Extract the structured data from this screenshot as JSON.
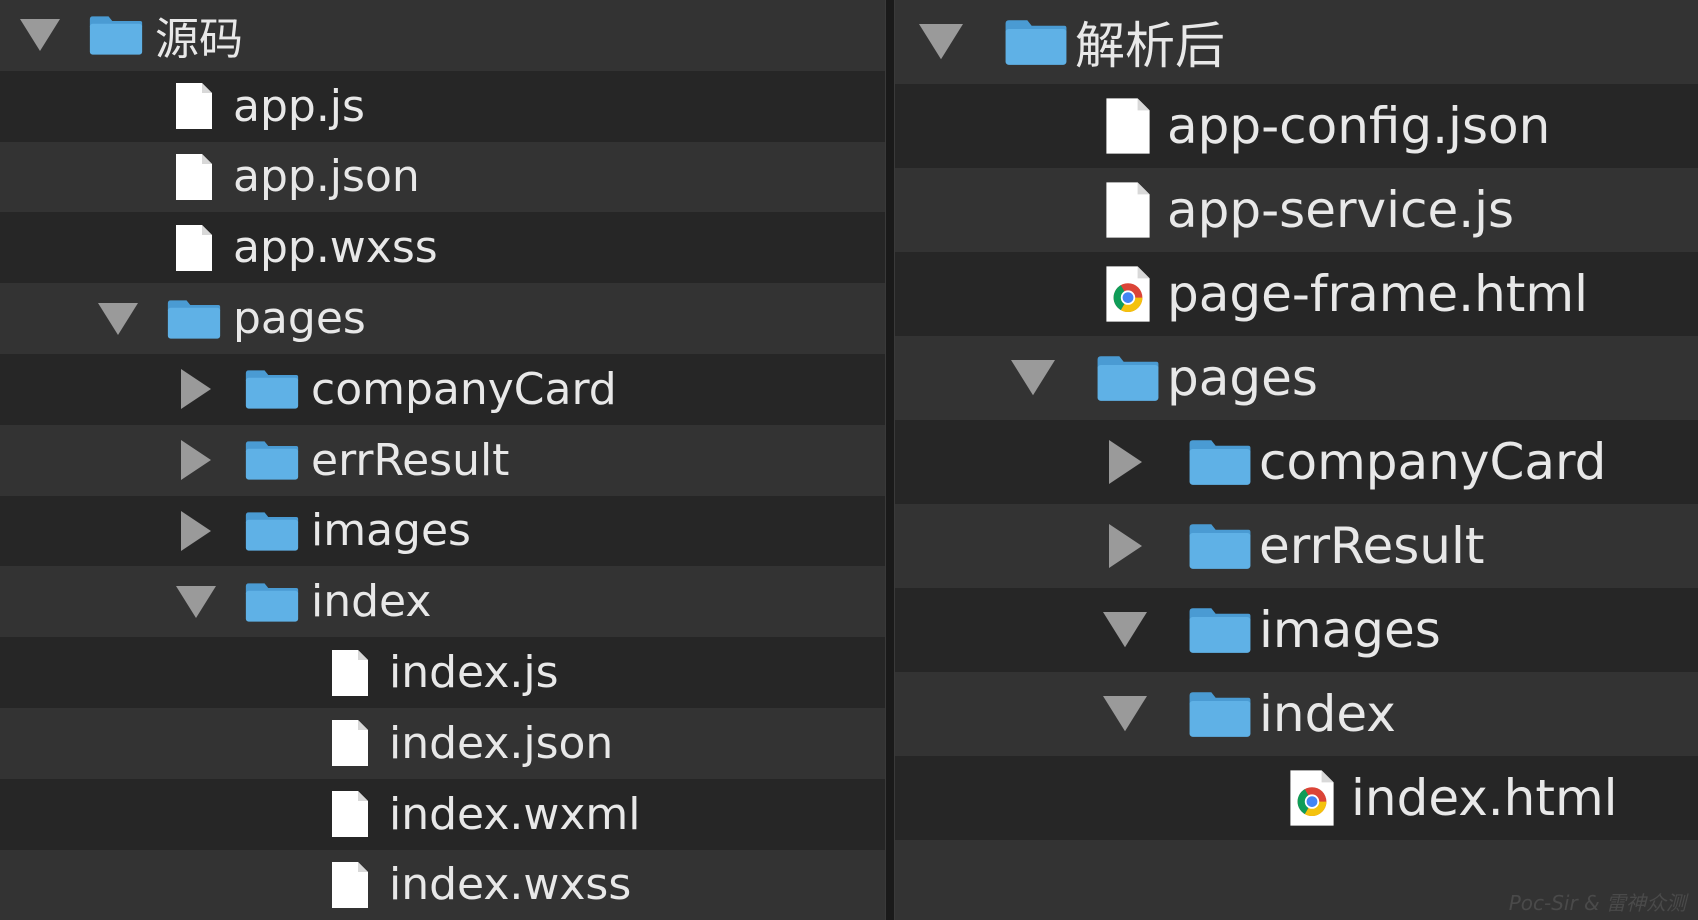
{
  "panes": [
    {
      "id": "left",
      "items": [
        {
          "label": "源码",
          "type": "folder",
          "expanded": true,
          "depth": 0
        },
        {
          "label": "app.js",
          "type": "file",
          "depth": 1
        },
        {
          "label": "app.json",
          "type": "file",
          "depth": 1
        },
        {
          "label": "app.wxss",
          "type": "file",
          "depth": 1
        },
        {
          "label": "pages",
          "type": "folder",
          "expanded": true,
          "depth": 1
        },
        {
          "label": "companyCard",
          "type": "folder",
          "expanded": false,
          "depth": 2
        },
        {
          "label": "errResult",
          "type": "folder",
          "expanded": false,
          "depth": 2
        },
        {
          "label": "images",
          "type": "folder",
          "expanded": false,
          "depth": 2
        },
        {
          "label": "index",
          "type": "folder",
          "expanded": true,
          "depth": 2
        },
        {
          "label": "index.js",
          "type": "file",
          "depth": 3
        },
        {
          "label": "index.json",
          "type": "file",
          "depth": 3
        },
        {
          "label": "index.wxml",
          "type": "file",
          "depth": 3
        },
        {
          "label": "index.wxss",
          "type": "file",
          "depth": 3
        }
      ]
    },
    {
      "id": "right",
      "items": [
        {
          "label": "解析后",
          "type": "folder",
          "expanded": true,
          "depth": 0
        },
        {
          "label": "app-config.json",
          "type": "file",
          "depth": 1
        },
        {
          "label": "app-service.js",
          "type": "file",
          "depth": 1
        },
        {
          "label": "page-frame.html",
          "type": "chrome",
          "depth": 1
        },
        {
          "label": "pages",
          "type": "folder",
          "expanded": true,
          "depth": 1
        },
        {
          "label": "companyCard",
          "type": "folder",
          "expanded": false,
          "depth": 2
        },
        {
          "label": "errResult",
          "type": "folder",
          "expanded": false,
          "depth": 2
        },
        {
          "label": "images",
          "type": "folder",
          "expanded": true,
          "depth": 2
        },
        {
          "label": "index",
          "type": "folder",
          "expanded": true,
          "depth": 2
        },
        {
          "label": "index.html",
          "type": "chrome",
          "depth": 3
        }
      ]
    }
  ],
  "watermark": "Poc-Sir & 雷神众测",
  "colors": {
    "folder": "#5fb1e6",
    "folder_tab": "#4a9bd3",
    "file": "#ffffff",
    "text": "#e8e8e8",
    "triangle": "#9a9a9a"
  }
}
